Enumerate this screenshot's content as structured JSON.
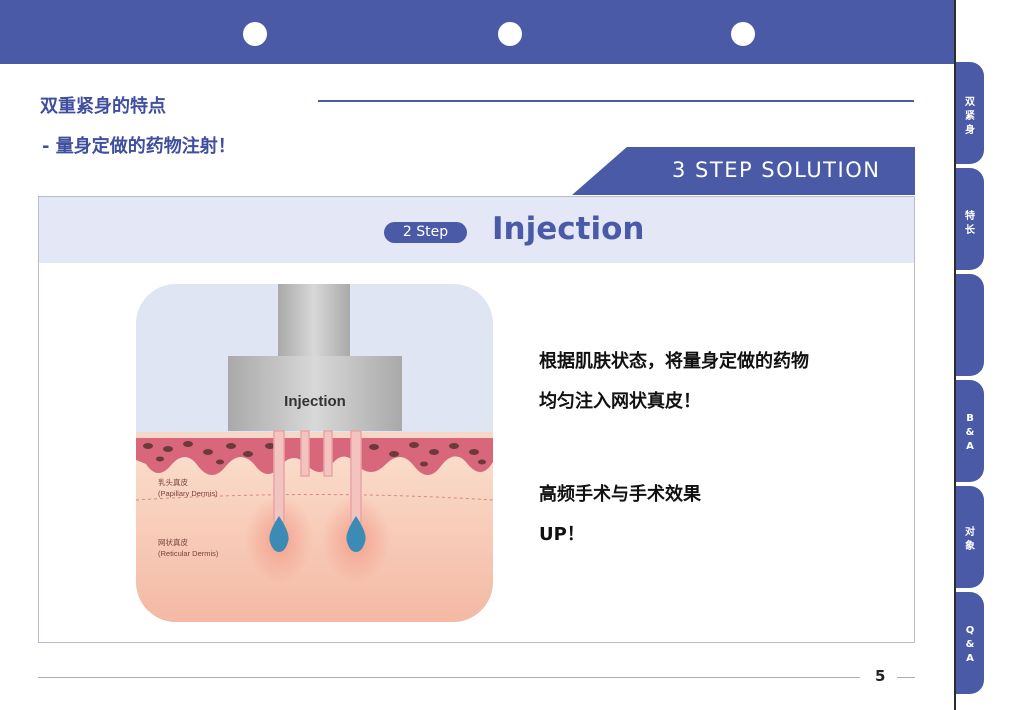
{
  "header": {
    "title": "双重紧身的特点",
    "subtitle": "- 量身定做的药物注射！",
    "solution_badge": "3 STEP SOLUTION"
  },
  "panel": {
    "step_pill": "2 Step",
    "step_title": "Injection"
  },
  "illustration": {
    "device_label": "Injection",
    "papillary_cn": "乳头真皮",
    "papillary_en": "(Papillary Dermis)",
    "reticular_cn": "网状真皮",
    "reticular_en": "(Reticular Dermis)"
  },
  "description": {
    "line1": "根据肌肤状态，将量身定做的药物",
    "line2": "均匀注入网状真皮！",
    "line3": "高频手术与手术效果",
    "line4": "UP！"
  },
  "footer": {
    "page_number": "5"
  },
  "side_tabs": [
    {
      "label": "双\n紧\n身"
    },
    {
      "label": "特\n长"
    },
    {
      "label": ""
    },
    {
      "label": "B\n&\nA"
    },
    {
      "label": "对\n象"
    },
    {
      "label": "Q\n&\nA"
    }
  ],
  "colors": {
    "brand": "#4a5aa6",
    "panel_header": "#e4e8f6",
    "droplet": "#3c8bb5"
  }
}
